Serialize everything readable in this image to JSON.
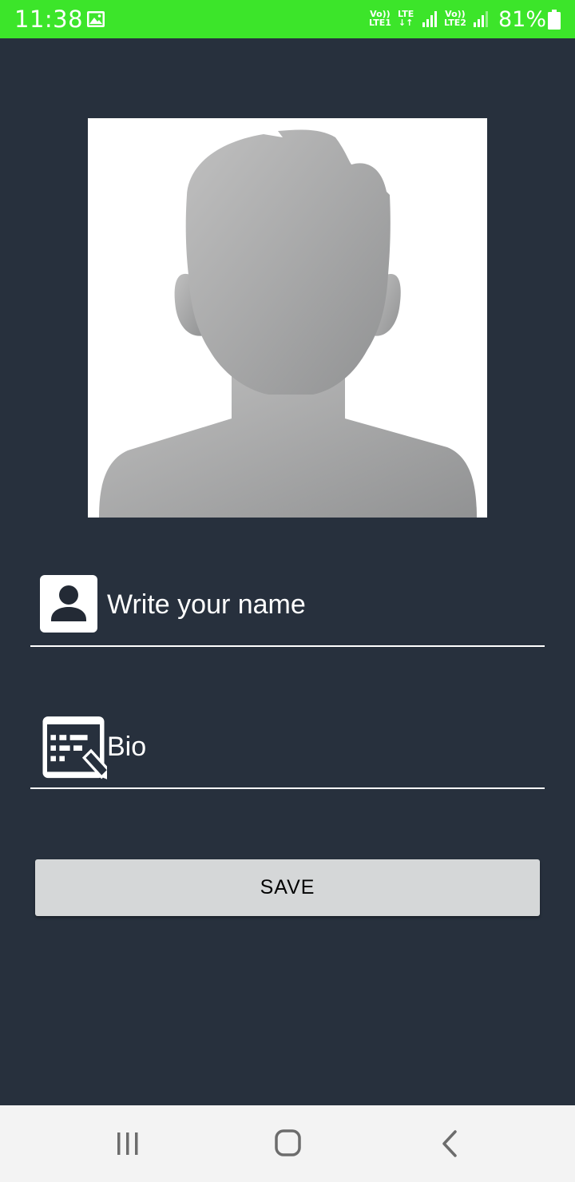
{
  "status_bar": {
    "time": "11:38",
    "sim1_top": "Vo))",
    "sim1_bottom": "LTE1",
    "data_top": "LTE",
    "data_bottom": "↓↑",
    "sim2_top": "Vo))",
    "sim2_bottom": "LTE2",
    "battery_percent": "81%",
    "battery_level": 0.81,
    "background_color": "#3ce52a"
  },
  "profile": {
    "avatar_icon": "default-person-silhouette",
    "name_field": {
      "placeholder": "Write your name",
      "value": "",
      "icon": "contact-card-icon"
    },
    "bio_field": {
      "placeholder": "Bio",
      "value": "",
      "icon": "edit-text-icon"
    },
    "save_label": "SAVE"
  },
  "nav_bar": {
    "recents_icon": "recents-icon",
    "home_icon": "home-icon",
    "back_icon": "back-icon"
  },
  "colors": {
    "background": "#27303d",
    "button": "#d5d7d8",
    "text": "#ffffff"
  }
}
